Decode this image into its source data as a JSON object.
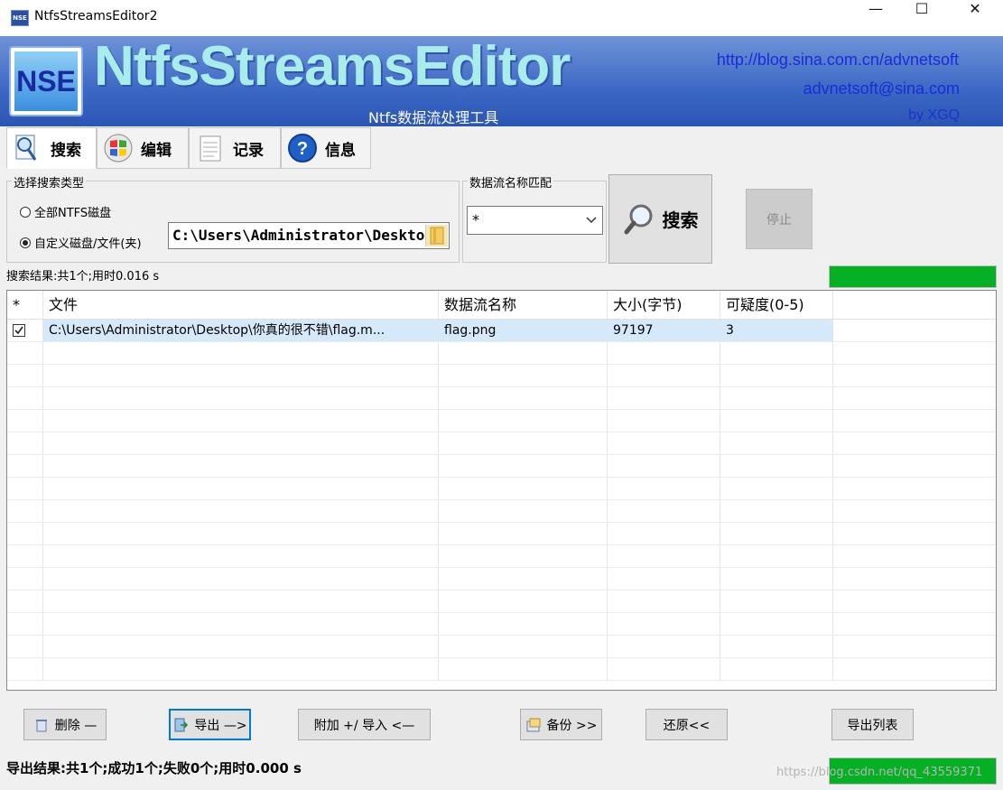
{
  "window": {
    "title": "NtfsStreamsEditor2",
    "app_icon": "NSE",
    "minimize": "—",
    "maximize": "☐",
    "close": "✕"
  },
  "banner": {
    "logo_text": "NSE",
    "brand": "NtfsStreamsEditor",
    "subtitle": "Ntfs数据流处理工具",
    "url": "http://blog.sina.com.cn/advnetsoft",
    "email": "advnetsoft@sina.com",
    "byline": "by XGQ"
  },
  "tabs": [
    {
      "label": "搜索",
      "icon": "search-doc-icon",
      "active": true
    },
    {
      "label": "编辑",
      "icon": "windows-logo-icon",
      "active": false
    },
    {
      "label": "记录",
      "icon": "notepad-icon",
      "active": false
    },
    {
      "label": "信息",
      "icon": "help-icon",
      "active": false
    }
  ],
  "search": {
    "type_group_label": "选择搜索类型",
    "option_all": "全部NTFS磁盘",
    "option_custom": "自定义磁盘/文件(夹)",
    "selected_option": "custom",
    "path_value": "C:\\Users\\Administrator\\Desktop\\",
    "match_group_label": "数据流名称匹配",
    "match_value": "*",
    "search_button": "搜索",
    "stop_button": "停止"
  },
  "search_status": "搜索结果:共1个;用时0.016 s",
  "search_progress": 1.0,
  "table": {
    "headers": [
      "*",
      "文件",
      "数据流名称",
      "大小(字节)",
      "可疑度(0-5)"
    ],
    "rows": [
      {
        "checked": true,
        "file": "C:\\Users\\Administrator\\Desktop\\你真的很不错\\flag.m...",
        "stream": "flag.png",
        "size": "97197",
        "suspicion": "3"
      }
    ]
  },
  "actions": {
    "delete": "删除 —",
    "export": "导出 —>",
    "attach_import": "附加 +/ 导入 <—",
    "backup": "备份  >>",
    "restore": "还原<<",
    "export_list": "导出列表"
  },
  "export_status": "导出结果:共1个;成功1个;失败0个;用时0.000 s",
  "export_progress": 1.0,
  "watermark": "https://blog.csdn.net/qq_43559371",
  "colors": {
    "banner": "#3c68c5",
    "progress": "#06b025",
    "selection": "#d5e9fb",
    "brand": "#a8ecec"
  }
}
